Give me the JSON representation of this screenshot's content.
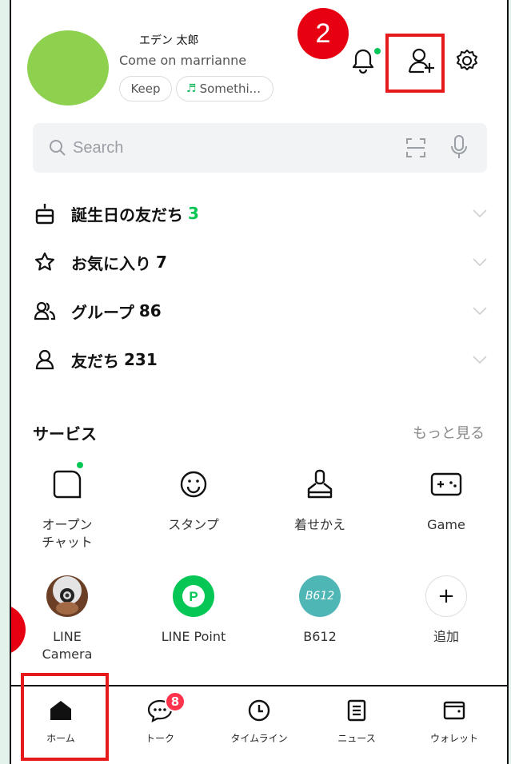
{
  "profile": {
    "name": "エデン 太郎",
    "status_message": "Come on marrianne",
    "chips": {
      "keep": "Keep",
      "music": "Somethi..."
    }
  },
  "annotation": {
    "step_label": "2"
  },
  "search": {
    "placeholder": "Search"
  },
  "lists": [
    {
      "label": "誕生日の友だち",
      "count": "3",
      "count_color": "#06c755",
      "icon": "cake-icon"
    },
    {
      "label": "お気に入り",
      "count": "7",
      "icon": "star-icon"
    },
    {
      "label": "グループ",
      "count": "86",
      "icon": "group-icon"
    },
    {
      "label": "友だち",
      "count": "231",
      "icon": "person-icon"
    }
  ],
  "services": {
    "title": "サービス",
    "more": "もっと見る",
    "items": [
      {
        "label": "オープン\nチャット",
        "icon": "open-chat-icon"
      },
      {
        "label": "スタンプ",
        "icon": "smiley-icon"
      },
      {
        "label": "着せかえ",
        "icon": "paintbrush-icon"
      },
      {
        "label": "Game",
        "icon": "gamepad-icon"
      },
      {
        "label": "LINE\nCamera",
        "icon": "line-camera-icon"
      },
      {
        "label": "LINE Point",
        "icon": "line-point-icon",
        "glyph": "P"
      },
      {
        "label": "B612",
        "icon": "b612-icon",
        "glyph": "B612"
      },
      {
        "label": "追加",
        "icon": "plus-icon",
        "glyph": "+"
      }
    ]
  },
  "nav": {
    "items": [
      {
        "label": "ホーム",
        "icon": "home-icon"
      },
      {
        "label": "トーク",
        "icon": "chat-icon",
        "badge": "8"
      },
      {
        "label": "タイムライン",
        "icon": "clock-icon"
      },
      {
        "label": "ニュース",
        "icon": "news-icon"
      },
      {
        "label": "ウォレット",
        "icon": "wallet-icon"
      }
    ]
  },
  "colors": {
    "accent": "#06c755",
    "annotation_red": "#e61a1a",
    "badge_red": "#ff334b"
  }
}
